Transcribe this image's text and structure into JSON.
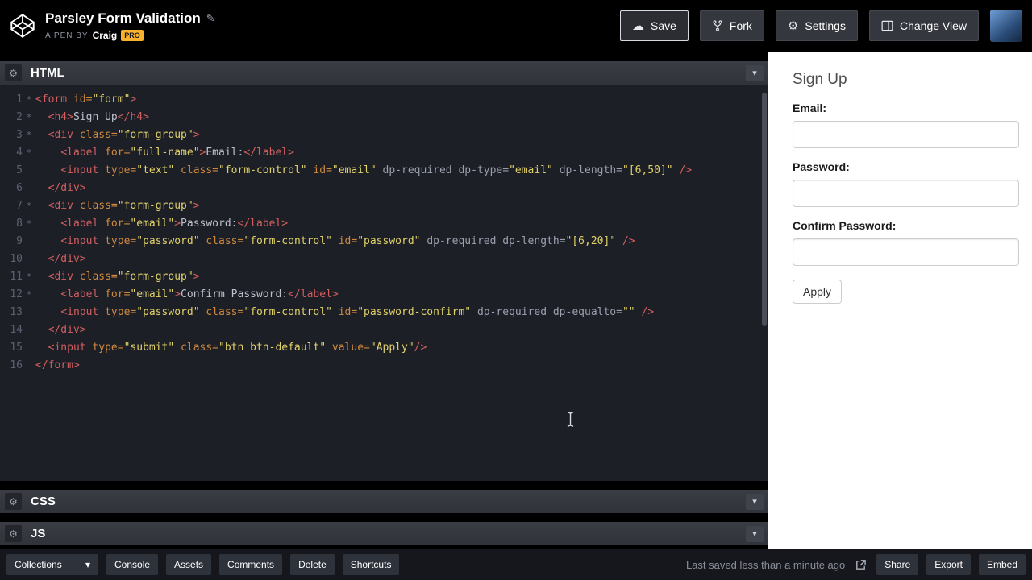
{
  "colors": {
    "header_bg": "#000000",
    "editor_bg": "#1d1f27",
    "panel_bar_bg": "#34373e",
    "preview_bg": "#ffffff",
    "pro_badge_bg": "#f7b32d",
    "tag_color": "#d25f5f",
    "attr_color": "#d08a3e",
    "string_color": "#e0d169",
    "plain_text_color": "#bcc1cc",
    "footer_bg": "#15171c"
  },
  "header": {
    "title": "Parsley Form Validation",
    "byline_label": "A PEN BY",
    "author": "Craig",
    "pro_badge": "PRO",
    "save_label": "Save",
    "fork_label": "Fork",
    "settings_label": "Settings",
    "change_view_label": "Change View"
  },
  "editors": {
    "html_title": "HTML",
    "css_title": "CSS",
    "js_title": "JS",
    "code_lines": [
      {
        "n": 1,
        "fold": true,
        "tokens": [
          [
            "tag",
            "<form "
          ],
          [
            "attr",
            "id="
          ],
          [
            "str",
            "\"form\""
          ],
          [
            "tag",
            ">"
          ]
        ]
      },
      {
        "n": 2,
        "fold": true,
        "tokens": [
          [
            "plain",
            "  "
          ],
          [
            "tag",
            "<h4>"
          ],
          [
            "text",
            "Sign Up"
          ],
          [
            "tag",
            "</h4>"
          ]
        ]
      },
      {
        "n": 3,
        "fold": true,
        "tokens": [
          [
            "plain",
            "  "
          ],
          [
            "tag",
            "<div "
          ],
          [
            "attr",
            "class="
          ],
          [
            "str",
            "\"form-group\""
          ],
          [
            "tag",
            ">"
          ]
        ]
      },
      {
        "n": 4,
        "fold": true,
        "tokens": [
          [
            "plain",
            "    "
          ],
          [
            "tag",
            "<label "
          ],
          [
            "attr",
            "for="
          ],
          [
            "str",
            "\"full-name\""
          ],
          [
            "tag",
            ">"
          ],
          [
            "text",
            "Email:"
          ],
          [
            "tag",
            "</label>"
          ]
        ]
      },
      {
        "n": 5,
        "fold": false,
        "tokens": [
          [
            "plain",
            "    "
          ],
          [
            "tag",
            "<input "
          ],
          [
            "attr",
            "type="
          ],
          [
            "str",
            "\"text\""
          ],
          [
            "plain",
            " "
          ],
          [
            "attr",
            "class="
          ],
          [
            "str",
            "\"form-control\""
          ],
          [
            "plain",
            " "
          ],
          [
            "attr",
            "id="
          ],
          [
            "str",
            "\"email\""
          ],
          [
            "plain",
            " "
          ],
          [
            "dp",
            "dp-required dp-type="
          ],
          [
            "str",
            "\"email\""
          ],
          [
            "plain",
            " "
          ],
          [
            "dp",
            "dp-length="
          ],
          [
            "str",
            "\"[6,50]\""
          ],
          [
            "plain",
            " "
          ],
          [
            "tag",
            "/>"
          ]
        ]
      },
      {
        "n": 6,
        "fold": false,
        "tokens": [
          [
            "plain",
            "  "
          ],
          [
            "tag",
            "</div>"
          ]
        ]
      },
      {
        "n": 7,
        "fold": true,
        "tokens": [
          [
            "plain",
            "  "
          ],
          [
            "tag",
            "<div "
          ],
          [
            "attr",
            "class="
          ],
          [
            "str",
            "\"form-group\""
          ],
          [
            "tag",
            ">"
          ]
        ]
      },
      {
        "n": 8,
        "fold": true,
        "tokens": [
          [
            "plain",
            "    "
          ],
          [
            "tag",
            "<label "
          ],
          [
            "attr",
            "for="
          ],
          [
            "str",
            "\"email\""
          ],
          [
            "tag",
            ">"
          ],
          [
            "text",
            "Password:"
          ],
          [
            "tag",
            "</label>"
          ]
        ]
      },
      {
        "n": 9,
        "fold": false,
        "tokens": [
          [
            "plain",
            "    "
          ],
          [
            "tag",
            "<input "
          ],
          [
            "attr",
            "type="
          ],
          [
            "str",
            "\"password\""
          ],
          [
            "plain",
            " "
          ],
          [
            "attr",
            "class="
          ],
          [
            "str",
            "\"form-control\""
          ],
          [
            "plain",
            " "
          ],
          [
            "attr",
            "id="
          ],
          [
            "str",
            "\"password\""
          ],
          [
            "plain",
            " "
          ],
          [
            "dp",
            "dp-required dp-length="
          ],
          [
            "str",
            "\"[6,20]\""
          ],
          [
            "plain",
            " "
          ],
          [
            "tag",
            "/>"
          ]
        ]
      },
      {
        "n": 10,
        "fold": false,
        "tokens": [
          [
            "plain",
            "  "
          ],
          [
            "tag",
            "</div>"
          ]
        ]
      },
      {
        "n": 11,
        "fold": true,
        "tokens": [
          [
            "plain",
            "  "
          ],
          [
            "tag",
            "<div "
          ],
          [
            "attr",
            "class="
          ],
          [
            "str",
            "\"form-group\""
          ],
          [
            "tag",
            ">"
          ]
        ]
      },
      {
        "n": 12,
        "fold": true,
        "tokens": [
          [
            "plain",
            "    "
          ],
          [
            "tag",
            "<label "
          ],
          [
            "attr",
            "for="
          ],
          [
            "str",
            "\"email\""
          ],
          [
            "tag",
            ">"
          ],
          [
            "text",
            "Confirm Password:"
          ],
          [
            "tag",
            "</label>"
          ]
        ]
      },
      {
        "n": 13,
        "fold": false,
        "tokens": [
          [
            "plain",
            "    "
          ],
          [
            "tag",
            "<input "
          ],
          [
            "attr",
            "type="
          ],
          [
            "str",
            "\"password\""
          ],
          [
            "plain",
            " "
          ],
          [
            "attr",
            "class="
          ],
          [
            "str",
            "\"form-control\""
          ],
          [
            "plain",
            " "
          ],
          [
            "attr",
            "id="
          ],
          [
            "str",
            "\"password-confirm\""
          ],
          [
            "plain",
            " "
          ],
          [
            "dp",
            "dp-required dp-equalto="
          ],
          [
            "str",
            "\"\""
          ],
          [
            "plain",
            " "
          ],
          [
            "tag",
            "/>"
          ]
        ]
      },
      {
        "n": 14,
        "fold": false,
        "tokens": [
          [
            "plain",
            "  "
          ],
          [
            "tag",
            "</div>"
          ]
        ]
      },
      {
        "n": 15,
        "fold": false,
        "tokens": [
          [
            "plain",
            "  "
          ],
          [
            "tag",
            "<input "
          ],
          [
            "attr",
            "type="
          ],
          [
            "str",
            "\"submit\""
          ],
          [
            "plain",
            " "
          ],
          [
            "attr",
            "class="
          ],
          [
            "str",
            "\"btn btn-default\""
          ],
          [
            "plain",
            " "
          ],
          [
            "attr",
            "value="
          ],
          [
            "str",
            "\"Apply\""
          ],
          [
            "tag",
            "/>"
          ]
        ]
      },
      {
        "n": 16,
        "fold": false,
        "tokens": [
          [
            "tag",
            "</form>"
          ]
        ]
      }
    ]
  },
  "preview": {
    "heading": "Sign Up",
    "fields": [
      {
        "label": "Email:",
        "value": "",
        "type": "text"
      },
      {
        "label": "Password:",
        "value": "",
        "type": "password"
      },
      {
        "label": "Confirm Password:",
        "value": "",
        "type": "password"
      }
    ],
    "submit_label": "Apply"
  },
  "footer": {
    "collections_label": "Collections",
    "buttons": [
      "Console",
      "Assets",
      "Comments",
      "Delete",
      "Shortcuts"
    ],
    "saved_status": "Last saved less than a minute ago",
    "right_buttons": [
      "Share",
      "Export",
      "Embed"
    ]
  }
}
